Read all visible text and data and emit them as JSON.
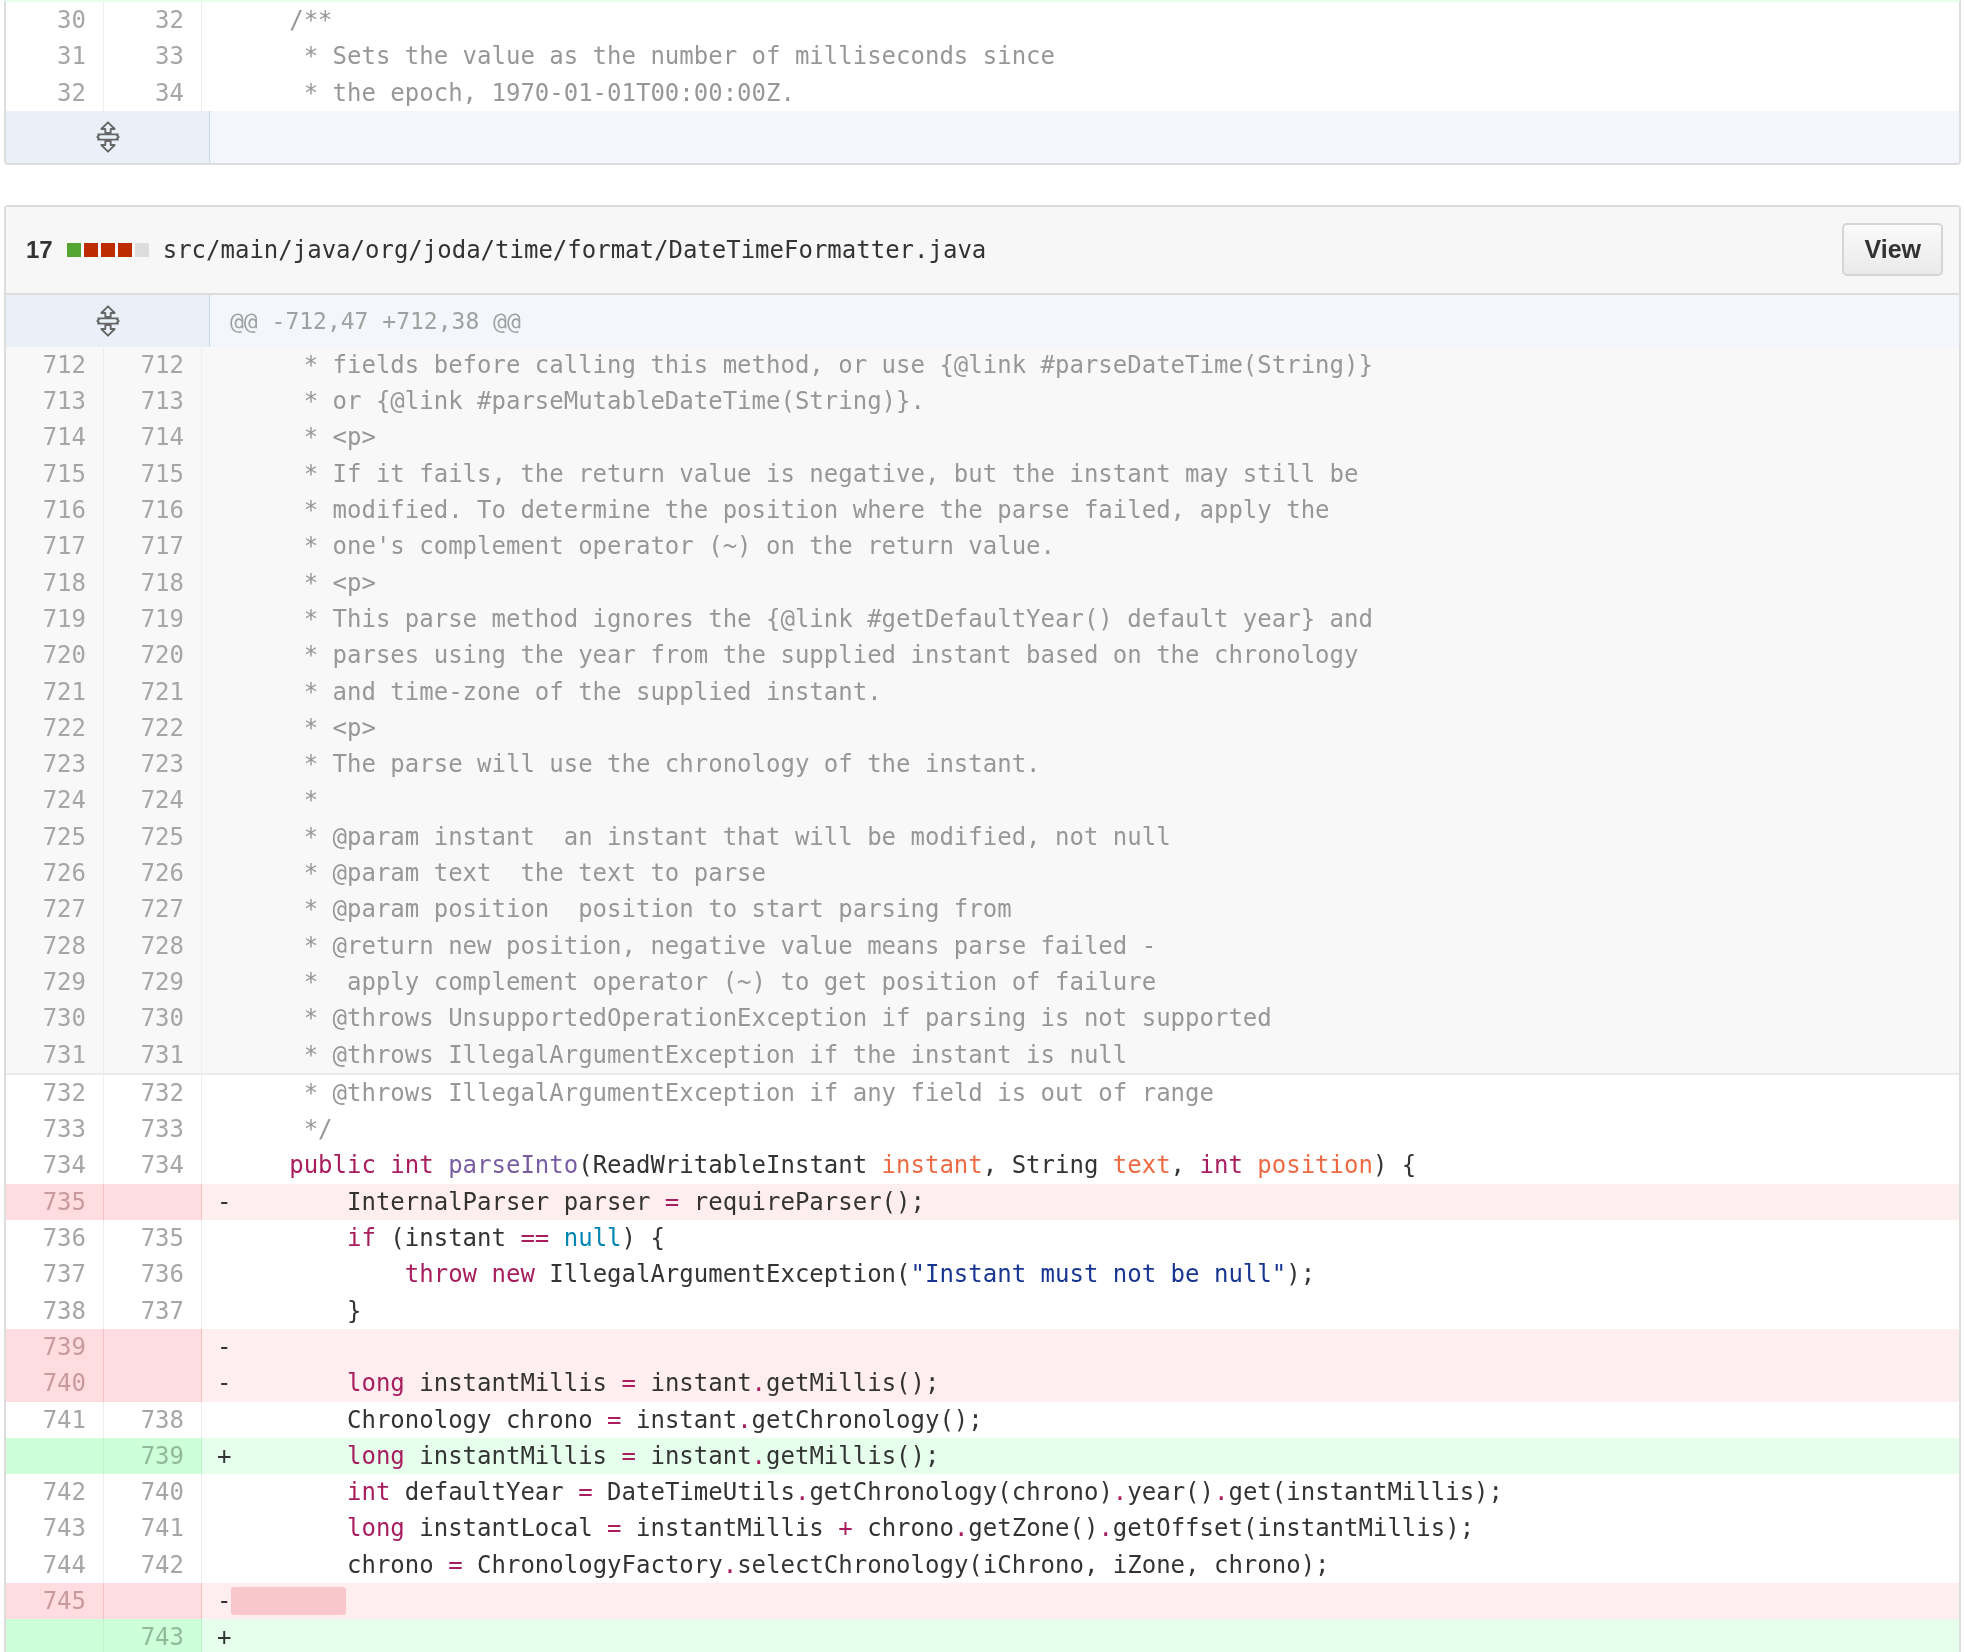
{
  "files": [
    {
      "rows": [
        {
          "kind": "context",
          "old": "30",
          "new": "32",
          "tokens": [
            {
              "text": "    /**",
              "kind": "comment"
            }
          ]
        },
        {
          "kind": "context",
          "old": "31",
          "new": "33",
          "tokens": [
            {
              "text": "     * Sets the value as the number of milliseconds since",
              "kind": "comment"
            }
          ]
        },
        {
          "kind": "context",
          "old": "32",
          "new": "34",
          "tokens": [
            {
              "text": "     * the epoch, 1970-01-01T00:00:00Z.",
              "kind": "comment"
            }
          ]
        }
      ],
      "expandable": true
    },
    {
      "header": {
        "changes": "17",
        "diffstat": [
          {
            "color": "#55a532"
          },
          {
            "color": "#bd2c00"
          },
          {
            "color": "#bd2c00"
          },
          {
            "color": "#bd2c00"
          },
          {
            "color": "#dddddd"
          }
        ],
        "path": "src/main/java/org/joda/time/format/DateTimeFormatter.java",
        "button": "View"
      },
      "expander_top": {
        "hunk": "@@ -712,47 +712,38 @@"
      },
      "rows": [
        {
          "kind": "expanded",
          "old": "712",
          "new": "712",
          "tokens": [
            {
              "text": "     * fields before calling this method, or use {@link #parseDateTime(String)}",
              "kind": "comment"
            }
          ]
        },
        {
          "kind": "expanded",
          "old": "713",
          "new": "713",
          "tokens": [
            {
              "text": "     * or {@link #parseMutableDateTime(String)}.",
              "kind": "comment"
            }
          ]
        },
        {
          "kind": "expanded",
          "old": "714",
          "new": "714",
          "tokens": [
            {
              "text": "     * <p>",
              "kind": "comment"
            }
          ]
        },
        {
          "kind": "expanded",
          "old": "715",
          "new": "715",
          "tokens": [
            {
              "text": "     * If it fails, the return value is negative, but the instant may still be",
              "kind": "comment"
            }
          ]
        },
        {
          "kind": "expanded",
          "old": "716",
          "new": "716",
          "tokens": [
            {
              "text": "     * modified. To determine the position where the parse failed, apply the",
              "kind": "comment"
            }
          ]
        },
        {
          "kind": "expanded",
          "old": "717",
          "new": "717",
          "tokens": [
            {
              "text": "     * one's complement operator (~) on the return value.",
              "kind": "comment"
            }
          ]
        },
        {
          "kind": "expanded",
          "old": "718",
          "new": "718",
          "tokens": [
            {
              "text": "     * <p>",
              "kind": "comment"
            }
          ]
        },
        {
          "kind": "expanded",
          "old": "719",
          "new": "719",
          "tokens": [
            {
              "text": "     * This parse method ignores the {@link #getDefaultYear() default year} and",
              "kind": "comment"
            }
          ]
        },
        {
          "kind": "expanded",
          "old": "720",
          "new": "720",
          "tokens": [
            {
              "text": "     * parses using the year from the supplied instant based on the chronology",
              "kind": "comment"
            }
          ]
        },
        {
          "kind": "expanded",
          "old": "721",
          "new": "721",
          "tokens": [
            {
              "text": "     * and time-zone of the supplied instant.",
              "kind": "comment"
            }
          ]
        },
        {
          "kind": "expanded",
          "old": "722",
          "new": "722",
          "tokens": [
            {
              "text": "     * <p>",
              "kind": "comment"
            }
          ]
        },
        {
          "kind": "expanded",
          "old": "723",
          "new": "723",
          "tokens": [
            {
              "text": "     * The parse will use the chronology of the instant.",
              "kind": "comment"
            }
          ]
        },
        {
          "kind": "expanded",
          "old": "724",
          "new": "724",
          "tokens": [
            {
              "text": "     *",
              "kind": "comment"
            }
          ]
        },
        {
          "kind": "expanded",
          "old": "725",
          "new": "725",
          "tokens": [
            {
              "text": "     * @param instant  an instant that will be modified, not null",
              "kind": "comment"
            }
          ]
        },
        {
          "kind": "expanded",
          "old": "726",
          "new": "726",
          "tokens": [
            {
              "text": "     * @param text  the text to parse",
              "kind": "comment"
            }
          ]
        },
        {
          "kind": "expanded",
          "old": "727",
          "new": "727",
          "tokens": [
            {
              "text": "     * @param position  position to start parsing from",
              "kind": "comment"
            }
          ]
        },
        {
          "kind": "expanded",
          "old": "728",
          "new": "728",
          "tokens": [
            {
              "text": "     * @return new position, negative value means parse failed -",
              "kind": "comment"
            }
          ]
        },
        {
          "kind": "expanded",
          "old": "729",
          "new": "729",
          "tokens": [
            {
              "text": "     *  apply complement operator (~) to get position of failure",
              "kind": "comment"
            }
          ]
        },
        {
          "kind": "expanded",
          "old": "730",
          "new": "730",
          "tokens": [
            {
              "text": "     * @throws UnsupportedOperationException if parsing is not supported",
              "kind": "comment"
            }
          ]
        },
        {
          "kind": "expanded",
          "old": "731",
          "new": "731",
          "tokens": [
            {
              "text": "     * @throws IllegalArgumentException if the instant is null",
              "kind": "comment"
            }
          ]
        },
        {
          "kind": "context",
          "old": "732",
          "new": "732",
          "tokens": [
            {
              "text": "     * @throws IllegalArgumentException if any field is out of range",
              "kind": "comment"
            }
          ]
        },
        {
          "kind": "context",
          "old": "733",
          "new": "733",
          "tokens": [
            {
              "text": "     */",
              "kind": "comment"
            }
          ]
        },
        {
          "kind": "context",
          "old": "734",
          "new": "734",
          "tokens": [
            {
              "text": "    public int",
              "kind": "keyword"
            },
            {
              "text": " parseInto",
              "kind": "entity"
            },
            {
              "text": "(ReadWritableInstant",
              "kind": "plain"
            },
            {
              "text": " instant",
              "kind": "parameter"
            },
            {
              "text": ", String",
              "kind": "plain"
            },
            {
              "text": " text",
              "kind": "parameter"
            },
            {
              "text": ",",
              "kind": "plain"
            },
            {
              "text": " int",
              "kind": "keyword"
            },
            {
              "text": " position",
              "kind": "parameter"
            },
            {
              "text": ") {",
              "kind": "plain"
            }
          ]
        },
        {
          "kind": "deletion",
          "old": "735",
          "sign": "-",
          "tokens": [
            {
              "text": "        InternalParser parser",
              "kind": "plain"
            },
            {
              "text": " =",
              "kind": "keyword"
            },
            {
              "text": " requireParser();",
              "kind": "plain"
            }
          ]
        },
        {
          "kind": "context",
          "old": "736",
          "new": "735",
          "tokens": [
            {
              "text": "        if",
              "kind": "keyword"
            },
            {
              "text": " (instant",
              "kind": "plain"
            },
            {
              "text": " ==",
              "kind": "keyword"
            },
            {
              "text": " null",
              "kind": "constant"
            },
            {
              "text": ") {",
              "kind": "plain"
            }
          ]
        },
        {
          "kind": "context",
          "old": "737",
          "new": "736",
          "tokens": [
            {
              "text": "            throw new",
              "kind": "keyword"
            },
            {
              "text": " IllegalArgumentException(",
              "kind": "plain"
            },
            {
              "text": "\"Instant must not be null\"",
              "kind": "string"
            },
            {
              "text": ");",
              "kind": "plain"
            }
          ]
        },
        {
          "kind": "context",
          "old": "738",
          "new": "737",
          "tokens": [
            {
              "text": "        }",
              "kind": "plain"
            }
          ]
        },
        {
          "kind": "deletion",
          "old": "739",
          "sign": "-"
        },
        {
          "kind": "deletion",
          "old": "740",
          "sign": "-",
          "tokens": [
            {
              "text": "        long",
              "kind": "keyword"
            },
            {
              "text": " instantMillis",
              "kind": "plain"
            },
            {
              "text": " =",
              "kind": "keyword"
            },
            {
              "text": " instant",
              "kind": "plain"
            },
            {
              "text": ".",
              "kind": "keyword"
            },
            {
              "text": "getMillis();",
              "kind": "plain"
            }
          ]
        },
        {
          "kind": "context",
          "old": "741",
          "new": "738",
          "tokens": [
            {
              "text": "        Chronology chrono",
              "kind": "plain"
            },
            {
              "text": " =",
              "kind": "keyword"
            },
            {
              "text": " instant",
              "kind": "plain"
            },
            {
              "text": ".",
              "kind": "keyword"
            },
            {
              "text": "getChronology();",
              "kind": "plain"
            }
          ]
        },
        {
          "kind": "addition",
          "new": "739",
          "sign": "+",
          "tokens": [
            {
              "text": "        long",
              "kind": "keyword"
            },
            {
              "text": " instantMillis",
              "kind": "plain"
            },
            {
              "text": " =",
              "kind": "keyword"
            },
            {
              "text": " instant",
              "kind": "plain"
            },
            {
              "text": ".",
              "kind": "keyword"
            },
            {
              "text": "getMillis();",
              "kind": "plain"
            }
          ]
        },
        {
          "kind": "context",
          "old": "742",
          "new": "740",
          "tokens": [
            {
              "text": "        int",
              "kind": "keyword"
            },
            {
              "text": " defaultYear",
              "kind": "plain"
            },
            {
              "text": " =",
              "kind": "keyword"
            },
            {
              "text": " DateTimeUtils",
              "kind": "plain"
            },
            {
              "text": ".",
              "kind": "keyword"
            },
            {
              "text": "getChronology(chrono)",
              "kind": "plain"
            },
            {
              "text": ".",
              "kind": "keyword"
            },
            {
              "text": "year()",
              "kind": "plain"
            },
            {
              "text": ".",
              "kind": "keyword"
            },
            {
              "text": "get(instantMillis);",
              "kind": "plain"
            }
          ]
        },
        {
          "kind": "context",
          "old": "743",
          "new": "741",
          "tokens": [
            {
              "text": "        long",
              "kind": "keyword"
            },
            {
              "text": " instantLocal",
              "kind": "plain"
            },
            {
              "text": " =",
              "kind": "keyword"
            },
            {
              "text": " instantMillis",
              "kind": "plain"
            },
            {
              "text": " +",
              "kind": "keyword"
            },
            {
              "text": " chrono",
              "kind": "plain"
            },
            {
              "text": ".",
              "kind": "keyword"
            },
            {
              "text": "getZone()",
              "kind": "plain"
            },
            {
              "text": ".",
              "kind": "keyword"
            },
            {
              "text": "getOffset(instantMillis);",
              "kind": "plain"
            }
          ]
        },
        {
          "kind": "context",
          "old": "744",
          "new": "742",
          "tokens": [
            {
              "text": "        chrono",
              "kind": "plain"
            },
            {
              "text": " =",
              "kind": "keyword"
            },
            {
              "text": " ChronologyFactory",
              "kind": "plain"
            },
            {
              "text": ".",
              "kind": "keyword"
            },
            {
              "text": "selectChronology(iChrono, iZone, chrono);",
              "kind": "plain"
            }
          ]
        },
        {
          "kind": "deletion",
          "old": "745",
          "sign": "-",
          "removed_whitespace": true
        },
        {
          "kind": "addition",
          "new": "743",
          "sign": "+"
        }
      ]
    }
  ]
}
